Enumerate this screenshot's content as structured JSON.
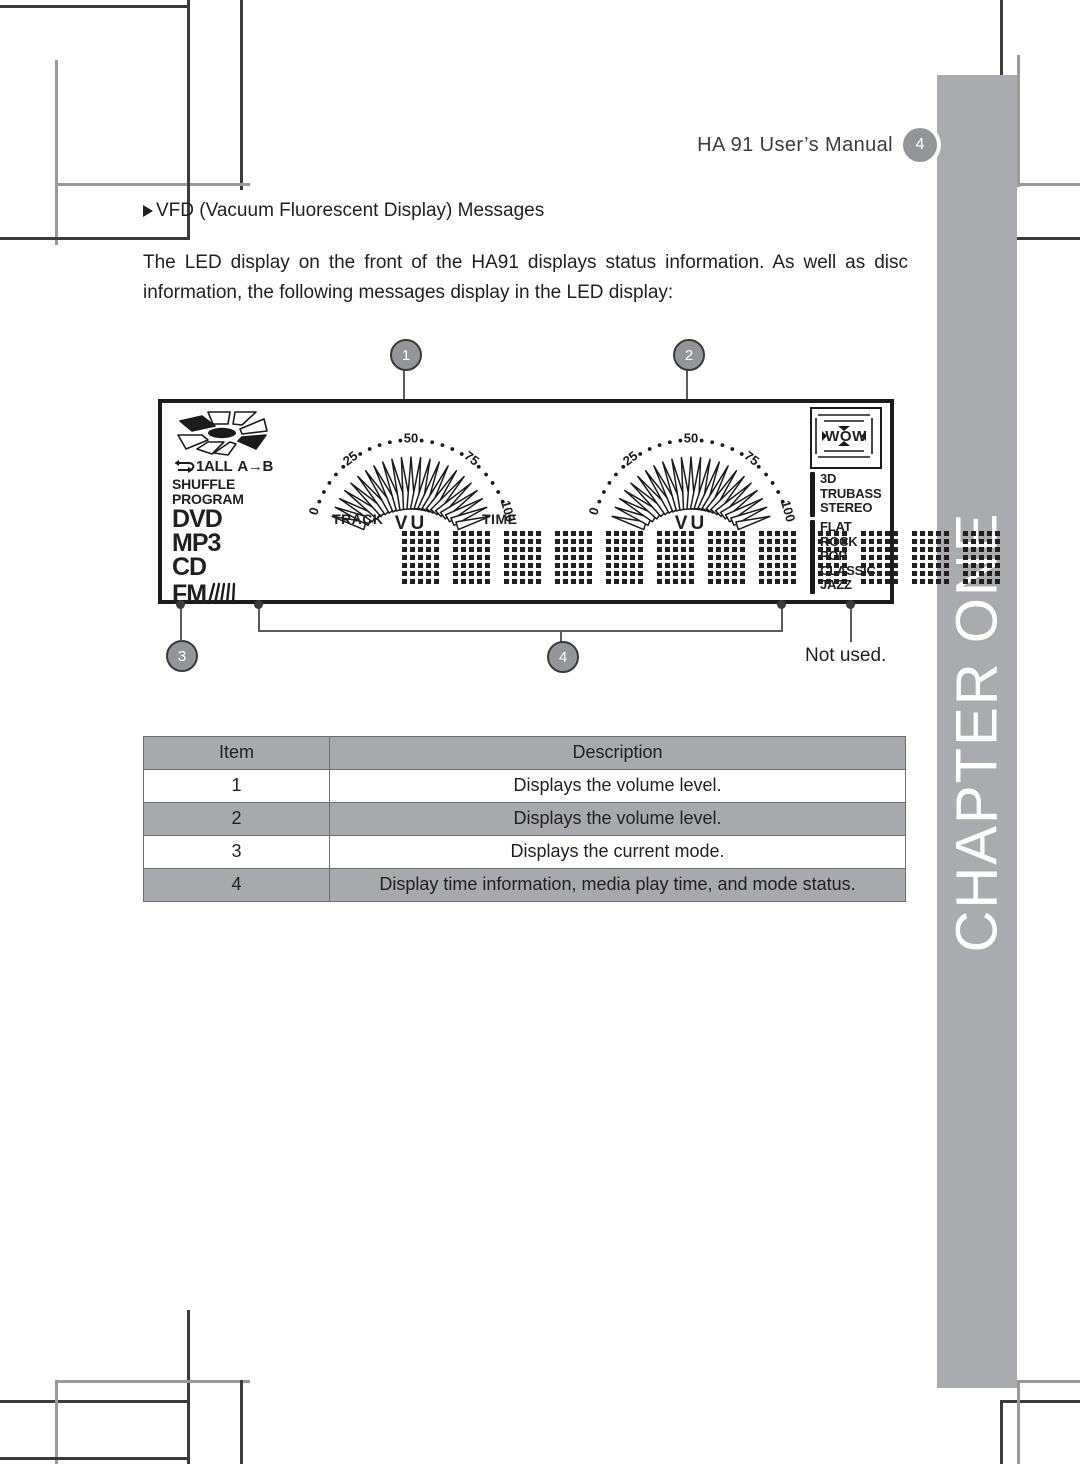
{
  "header": {
    "title": "HA 91 User’s Manual",
    "page_number": "4"
  },
  "section": {
    "heading": "VFD (Vacuum Fluorescent Display) Messages"
  },
  "intro": "The LED display on the front of the HA91 displays status information. As well as disc information, the following messages display in the LED display:",
  "callouts": [
    {
      "id": "1",
      "label": "1"
    },
    {
      "id": "2",
      "label": "2"
    },
    {
      "id": "3",
      "label": "3"
    },
    {
      "id": "4",
      "label": "4"
    }
  ],
  "not_used_note": "Not used.",
  "vfd": {
    "mode_indicators": {
      "repeat": {
        "one": "1",
        "all": "ALL",
        "ab": "A→B"
      },
      "shuffle": "SHUFFLE",
      "program": "PROGRAM",
      "dvd": "DVD",
      "mp3": "MP3",
      "cd": "CD",
      "fm": "FM"
    },
    "vu_meters": [
      {
        "name": "left-vu",
        "label": "VU",
        "scale_ticks": [
          "0",
          "25",
          "50",
          "75",
          "100"
        ],
        "segments": 23
      },
      {
        "name": "right-vu",
        "label": "VU",
        "scale_ticks": [
          "0",
          "25",
          "50",
          "75",
          "100"
        ],
        "segments": 23
      }
    ],
    "field_labels": {
      "track": "TRACK",
      "time": "TIME"
    },
    "dot_matrix": {
      "cells": 12,
      "cols": 5,
      "rows": 7
    },
    "effects": {
      "wow_logo": "WOW",
      "sound_modes": [
        "3D",
        "TRUBASS",
        "STEREO"
      ],
      "eq_presets": [
        "FLAT",
        "ROCK",
        "POP",
        "CLASSIC",
        "JAZZ"
      ]
    }
  },
  "table": {
    "columns": [
      "Item",
      "Description"
    ],
    "rows": [
      {
        "item": "1",
        "description": "Displays the volume level."
      },
      {
        "item": "2",
        "description": "Displays the volume level."
      },
      {
        "item": "3",
        "description": "Displays the current mode."
      },
      {
        "item": "4",
        "description": "Display time information, media play time, and mode status."
      }
    ]
  },
  "chapter_tab": {
    "label": "CHAPTER ONE"
  },
  "colors": {
    "chapter_bar": "#a9abae",
    "table_header": "#a7a9ac",
    "callout_fill": "#939598",
    "ink": "#231f20"
  }
}
